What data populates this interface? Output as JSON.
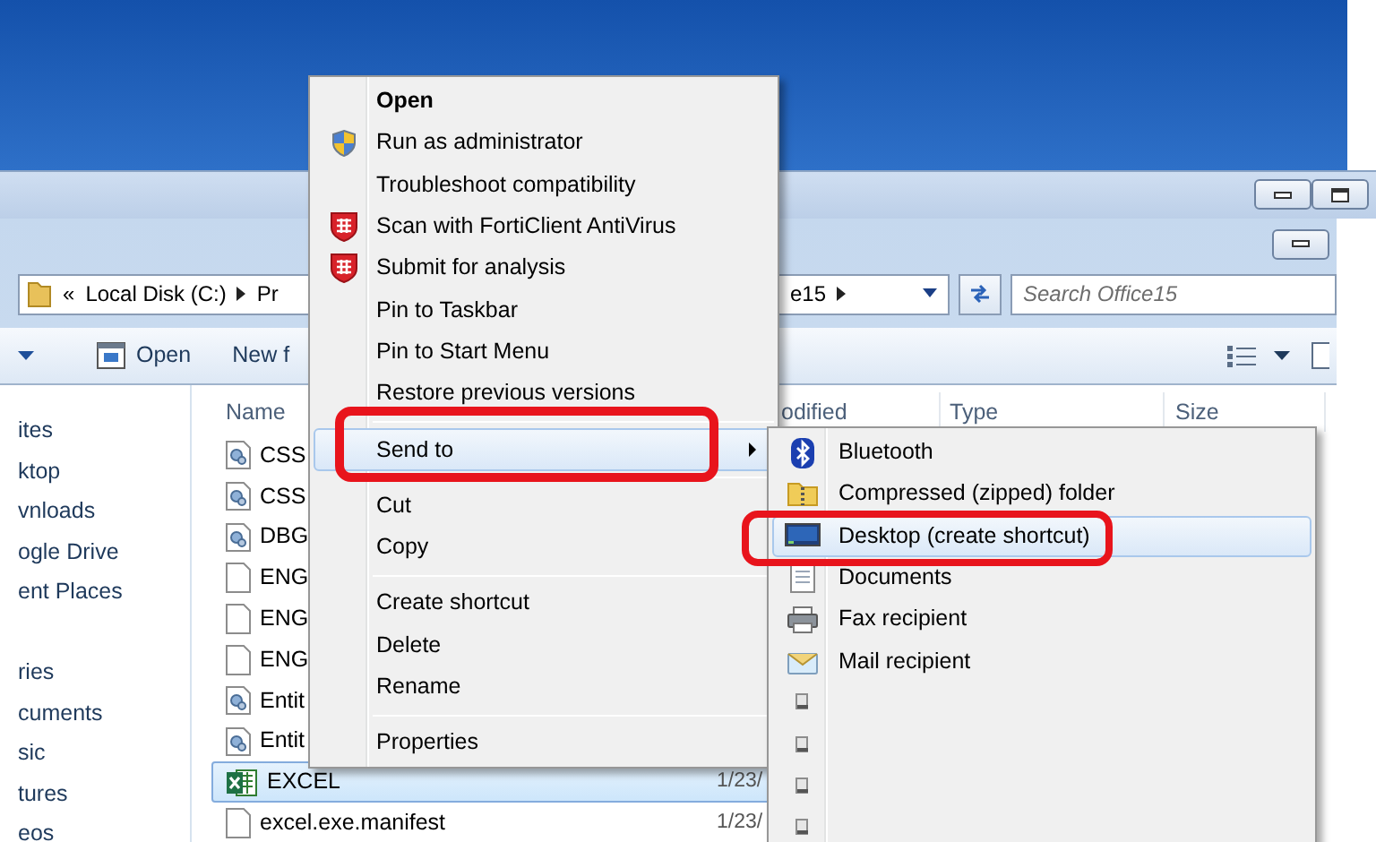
{
  "explorer": {
    "address_bar": {
      "lead": "«",
      "segments": [
        {
          "text": "Local Disk (C:)",
          "arrow": true
        },
        {
          "text": "Pr",
          "arrow": false
        }
      ],
      "tail_segments": [
        {
          "text": "e15",
          "arrow": true
        }
      ],
      "search_placeholder": "Search Office15"
    },
    "toolbar": {
      "buttons": [
        {
          "label": "Open",
          "kind": "open"
        },
        {
          "label": "New f",
          "kind": "plain"
        }
      ]
    },
    "nav_pane": {
      "groups": [
        [
          "ites",
          "ktop",
          "vnloads",
          "ogle Drive",
          "ent Places"
        ],
        [
          "ries",
          "cuments",
          "sic",
          "tures",
          "eos"
        ]
      ]
    },
    "columns": [
      {
        "label": "Name"
      },
      {
        "label": "odified"
      },
      {
        "label": "Type"
      },
      {
        "label": "Size"
      }
    ],
    "files": [
      {
        "name": "CSS",
        "kind": "config",
        "selected": false
      },
      {
        "name": "CSS",
        "kind": "config",
        "selected": false
      },
      {
        "name": "DBG",
        "kind": "config",
        "selected": false
      },
      {
        "name": "ENG",
        "kind": "blank",
        "selected": false
      },
      {
        "name": "ENG",
        "kind": "blank",
        "selected": false
      },
      {
        "name": "ENG",
        "kind": "blank",
        "selected": false
      },
      {
        "name": "Entit",
        "kind": "config",
        "selected": false
      },
      {
        "name": "Entit",
        "kind": "config",
        "selected": false
      },
      {
        "name": "EXCEL",
        "kind": "excel",
        "selected": true,
        "date": "1/23/"
      },
      {
        "name": "excel.exe.manifest",
        "kind": "blank",
        "selected": false,
        "date": "1/23/"
      }
    ]
  },
  "context_menu": {
    "items": [
      {
        "kind": "default",
        "label": "Open",
        "selected": false,
        "outlined": false
      },
      {
        "kind": "uac",
        "label": "Run as administrator",
        "selected": false,
        "outlined": false
      },
      {
        "kind": "plain",
        "label": "Troubleshoot compatibility",
        "selected": false,
        "outlined": false
      },
      {
        "kind": "antivirus",
        "label": "Scan with FortiClient AntiVirus",
        "selected": false,
        "outlined": false
      },
      {
        "kind": "antivirus",
        "label": "Submit for analysis",
        "selected": false,
        "outlined": false
      },
      {
        "kind": "plain",
        "label": "Pin to Taskbar",
        "selected": false,
        "outlined": false
      },
      {
        "kind": "plain",
        "label": "Pin to Start Menu",
        "selected": false,
        "outlined": false
      },
      {
        "kind": "plain",
        "label": "Restore previous versions",
        "selected": false,
        "outlined": false
      },
      {
        "kind": "separator"
      },
      {
        "kind": "submenu",
        "label": "Send to",
        "selected": true,
        "outlined": true
      },
      {
        "kind": "separator"
      },
      {
        "kind": "plain",
        "label": "Cut",
        "selected": false,
        "outlined": false
      },
      {
        "kind": "plain",
        "label": "Copy",
        "selected": false,
        "outlined": false
      },
      {
        "kind": "separator"
      },
      {
        "kind": "plain",
        "label": "Create shortcut",
        "selected": false,
        "outlined": false
      },
      {
        "kind": "plain",
        "label": "Delete",
        "selected": false,
        "outlined": false
      },
      {
        "kind": "plain",
        "label": "Rename",
        "selected": false,
        "outlined": false
      },
      {
        "kind": "separator"
      },
      {
        "kind": "plain",
        "label": "Properties",
        "selected": false,
        "outlined": false
      }
    ]
  },
  "send_to_menu": {
    "items": [
      {
        "kind": "bluetooth",
        "label": "Bluetooth",
        "selected": false,
        "outlined": false
      },
      {
        "kind": "zip",
        "label": "Compressed (zipped) folder",
        "selected": false,
        "outlined": false
      },
      {
        "kind": "desktop",
        "label": "Desktop (create shortcut)",
        "selected": true,
        "outlined": true
      },
      {
        "kind": "documents",
        "label": "Documents",
        "selected": false,
        "outlined": false
      },
      {
        "kind": "fax",
        "label": "Fax recipient",
        "selected": false,
        "outlined": false
      },
      {
        "kind": "mail",
        "label": "Mail recipient",
        "selected": false,
        "outlined": false
      },
      {
        "kind": "drive",
        "selected": false,
        "outlined": false
      },
      {
        "kind": "drive",
        "selected": false,
        "outlined": false
      },
      {
        "kind": "drive",
        "selected": false,
        "outlined": false
      },
      {
        "kind": "drive",
        "selected": false,
        "outlined": false
      }
    ]
  }
}
